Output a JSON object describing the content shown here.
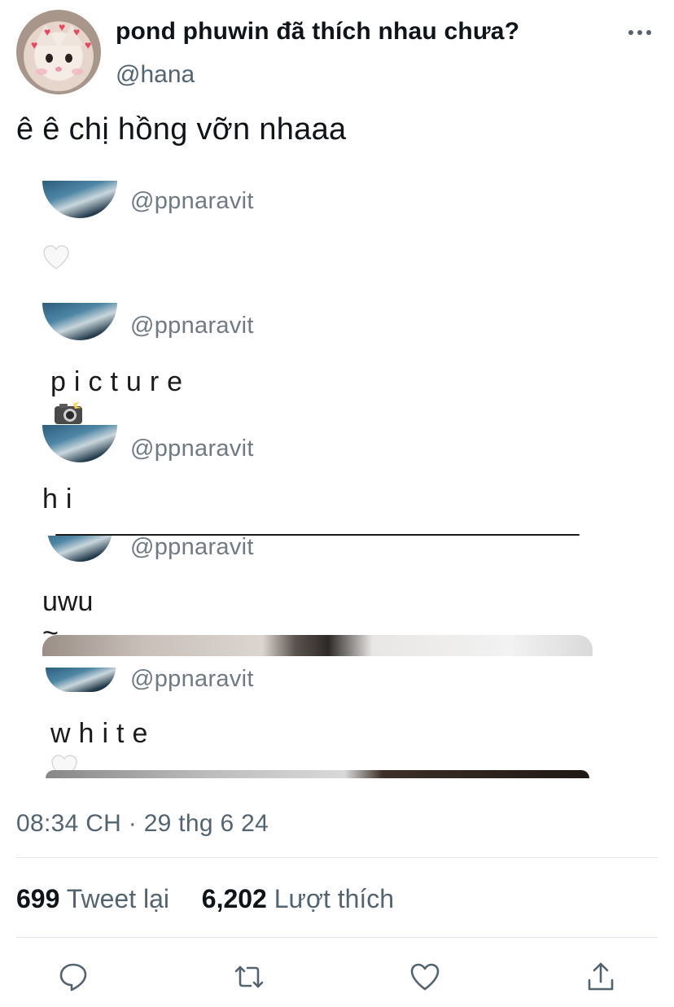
{
  "header": {
    "display_name": "pond phuwin đã thích nhau chưa?",
    "handle": "@hana",
    "more_icon": "more-horizontal-icon"
  },
  "tweet": {
    "text": "ê ê chị hồng vỡn nhaaa"
  },
  "embedded_posts": [
    {
      "handle": "@ppnaravit",
      "text": "🤍"
    },
    {
      "handle": "@ppnaravit",
      "text": "picture"
    },
    {
      "handle": "@ppnaravit",
      "text": "hi"
    },
    {
      "handle": "@ppnaravit",
      "text": "uwu ~"
    },
    {
      "handle": "@ppnaravit",
      "text": "white"
    }
  ],
  "meta": {
    "timestamp": "08:34 CH · 29 thg 6 24"
  },
  "stats": {
    "retweets_count": "699",
    "retweets_label": "Tweet lại",
    "likes_count": "6,202",
    "likes_label": "Lượt thích"
  },
  "actions": [
    "reply-icon",
    "retweet-icon",
    "like-icon",
    "share-icon"
  ],
  "colors": {
    "text_primary": "#0f1419",
    "text_secondary": "#536471",
    "divider": "#e1e4e8"
  }
}
